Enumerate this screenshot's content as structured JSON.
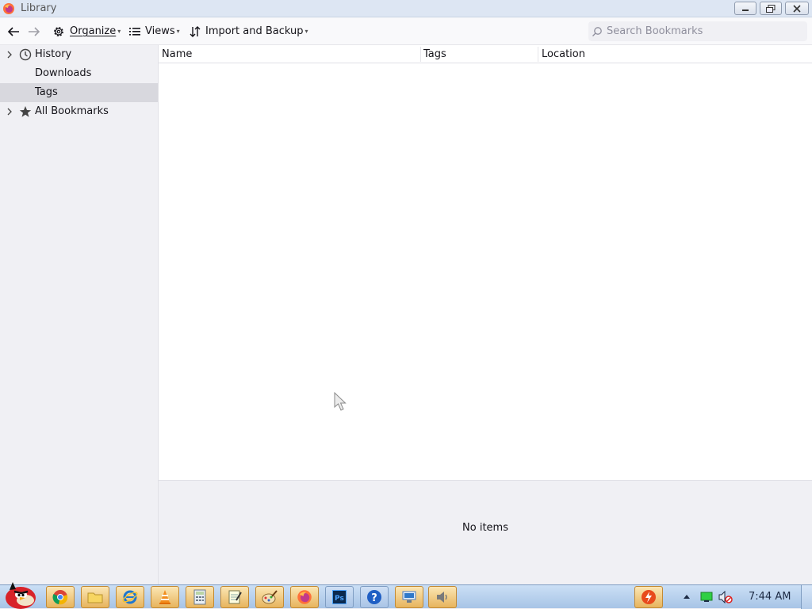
{
  "window": {
    "title": "Library",
    "controls": [
      "minimize",
      "maximize",
      "close"
    ]
  },
  "toolbar": {
    "organize_label": "Organize",
    "views_label": "Views",
    "import_label": "Import and Backup",
    "search_placeholder": "Search Bookmarks"
  },
  "sidebar": {
    "items": [
      {
        "label": "History",
        "icon": "clock-icon",
        "expandable": true
      },
      {
        "label": "Downloads",
        "icon": "",
        "expandable": false
      },
      {
        "label": "Tags",
        "icon": "",
        "expandable": false,
        "selected": true
      },
      {
        "label": "All Bookmarks",
        "icon": "star-icon",
        "expandable": true
      }
    ]
  },
  "table": {
    "columns": [
      "Name",
      "Tags",
      "Location"
    ],
    "rows": []
  },
  "details": {
    "empty_text": "No items"
  },
  "taskbar": {
    "pinned": [
      "angry-birds-start",
      "chrome",
      "folder",
      "internet-explorer",
      "vlc",
      "calculator",
      "notepad",
      "paint",
      "firefox",
      "photoshop",
      "help",
      "network",
      "volume"
    ],
    "clock": "7:44 AM"
  },
  "colors": {
    "selected_bg": "#d8d8de",
    "sidebar_bg": "#f0f0f4",
    "titlebar_bg": "#dde6f3"
  }
}
